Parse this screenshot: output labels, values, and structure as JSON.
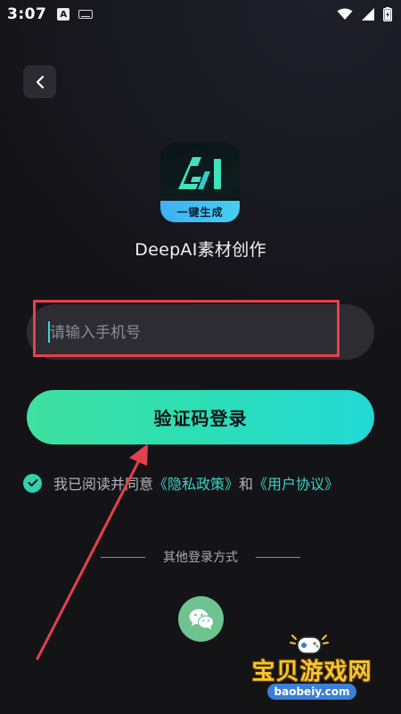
{
  "status_bar": {
    "time": "3:07",
    "indicator_letter": "A"
  },
  "logo": {
    "mark": "AI",
    "banner": "一键生成"
  },
  "app_name": "DeepAI素材创作",
  "phone_input": {
    "placeholder": "请输入手机号",
    "value": ""
  },
  "login_button_label": "验证码登录",
  "agreement": {
    "checked": true,
    "prefix": "我已阅读并同意",
    "privacy_link": "《隐私政策》",
    "conjunction": "和",
    "user_agreement_link": "《用户协议》"
  },
  "other_login_label": "其他登录方式",
  "watermark": {
    "name": "宝贝游戏网",
    "url": "baobeiy.com"
  },
  "colors": {
    "accent": "#2fd3ad",
    "link": "#39d3c2",
    "annotation_red": "#e2424d",
    "wechat_green": "#6fc391"
  }
}
